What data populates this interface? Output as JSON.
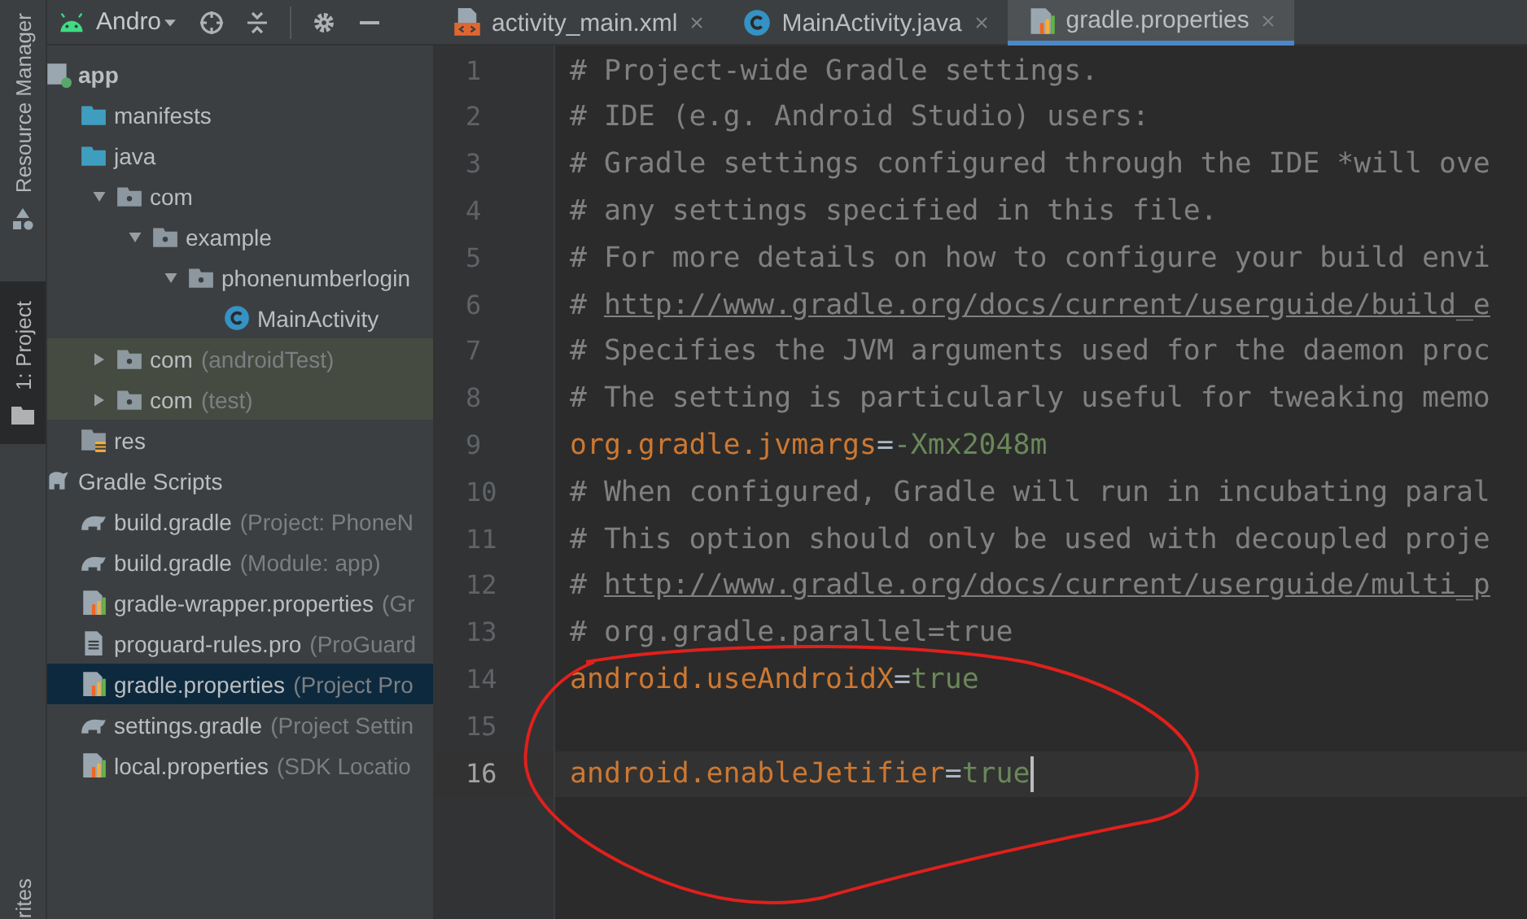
{
  "tool_strip": {
    "items": [
      {
        "label": "Resource Manager",
        "kind": "shapes",
        "selected": false
      },
      {
        "label": "1: Project",
        "kind": "folder",
        "selected": true
      }
    ],
    "bottom_label": "rites"
  },
  "project_panel": {
    "view": "Andro",
    "tree": [
      {
        "label": "app",
        "kind": "module",
        "selected": false,
        "children": [
          {
            "label": "manifests",
            "kind": "sourcefolder",
            "selected": false
          },
          {
            "label": "java",
            "kind": "sourcefolder",
            "selected": false,
            "children": [
              {
                "label": "com",
                "kind": "package",
                "expanded": true,
                "selected": false,
                "children": [
                  {
                    "label": "example",
                    "kind": "package",
                    "expanded": true,
                    "selected": false,
                    "children": [
                      {
                        "label": "phonenumberlogin",
                        "kind": "package",
                        "expanded": true,
                        "selected": false,
                        "children": [
                          {
                            "label": "MainActivity",
                            "kind": "class",
                            "selected": false
                          }
                        ]
                      }
                    ]
                  }
                ]
              },
              {
                "label": "com",
                "hint": "(androidTest)",
                "kind": "package",
                "expanded": false,
                "test": true,
                "selected": false
              },
              {
                "label": "com",
                "hint": "(test)",
                "kind": "package",
                "expanded": false,
                "test": true,
                "selected": false
              }
            ]
          },
          {
            "label": "res",
            "kind": "resfolder",
            "selected": false
          }
        ]
      },
      {
        "label": "Gradle Scripts",
        "kind": "scripts",
        "selected": false,
        "children": [
          {
            "label": "build.gradle",
            "hint": "(Project: PhoneN",
            "kind": "gradle",
            "selected": false
          },
          {
            "label": "build.gradle",
            "hint": "(Module: app)",
            "kind": "gradle",
            "selected": false
          },
          {
            "label": "gradle-wrapper.properties",
            "hint": "(Gr",
            "kind": "properties",
            "selected": false
          },
          {
            "label": "proguard-rules.pro",
            "hint": "(ProGuard",
            "kind": "text",
            "selected": false
          },
          {
            "label": "gradle.properties",
            "hint": "(Project Pro",
            "kind": "properties",
            "selected": true
          },
          {
            "label": "settings.gradle",
            "hint": "(Project Settin",
            "kind": "gradle",
            "selected": false
          },
          {
            "label": "local.properties",
            "hint": "(SDK Locatio",
            "kind": "properties",
            "selected": false
          }
        ]
      }
    ]
  },
  "tabs": [
    {
      "label": "activity_main.xml",
      "kind": "xml",
      "selected": false
    },
    {
      "label": "MainActivity.java",
      "kind": "class",
      "selected": false
    },
    {
      "label": "gradle.properties",
      "kind": "properties",
      "selected": true
    }
  ],
  "editor": {
    "lines": [
      {
        "number": "1",
        "current": false,
        "segments": [
          {
            "kind": "comment",
            "text": "# Project-wide Gradle settings."
          }
        ]
      },
      {
        "number": "2",
        "current": false,
        "segments": [
          {
            "kind": "comment",
            "text": "# IDE (e.g. Android Studio) users:"
          }
        ]
      },
      {
        "number": "3",
        "current": false,
        "segments": [
          {
            "kind": "comment",
            "text": "# Gradle settings configured through the IDE *will ove"
          }
        ]
      },
      {
        "number": "4",
        "current": false,
        "segments": [
          {
            "kind": "comment",
            "text": "# any settings specified in this file."
          }
        ]
      },
      {
        "number": "5",
        "current": false,
        "segments": [
          {
            "kind": "comment",
            "text": "# For more details on how to configure your build envi"
          }
        ]
      },
      {
        "number": "6",
        "current": false,
        "segments": [
          {
            "kind": "comment",
            "text": "# "
          },
          {
            "kind": "link",
            "text": "http://www.gradle.org/docs/current/userguide/build_e"
          }
        ]
      },
      {
        "number": "7",
        "current": false,
        "segments": [
          {
            "kind": "comment",
            "text": "# Specifies the JVM arguments used for the daemon proc"
          }
        ]
      },
      {
        "number": "8",
        "current": false,
        "segments": [
          {
            "kind": "comment",
            "text": "# The setting is particularly useful for tweaking memo"
          }
        ]
      },
      {
        "number": "9",
        "current": false,
        "segments": [
          {
            "kind": "key",
            "text": "org.gradle.jvmargs"
          },
          {
            "kind": "separator",
            "text": "="
          },
          {
            "kind": "value",
            "text": "-Xmx2048m"
          }
        ]
      },
      {
        "number": "10",
        "current": false,
        "segments": [
          {
            "kind": "comment",
            "text": "# When configured, Gradle will run in incubating paral"
          }
        ]
      },
      {
        "number": "11",
        "current": false,
        "segments": [
          {
            "kind": "comment",
            "text": "# This option should only be used with decoupled proje"
          }
        ]
      },
      {
        "number": "12",
        "current": false,
        "segments": [
          {
            "kind": "comment",
            "text": "# "
          },
          {
            "kind": "link",
            "text": "http://www.gradle.org/docs/current/userguide/multi_p"
          }
        ]
      },
      {
        "number": "13",
        "current": false,
        "segments": [
          {
            "kind": "comment",
            "text": "# org.gradle.parallel=true"
          }
        ]
      },
      {
        "number": "14",
        "current": false,
        "segments": [
          {
            "kind": "key",
            "text": "android.useAndroidX"
          },
          {
            "kind": "separator",
            "text": "="
          },
          {
            "kind": "value",
            "text": "true"
          }
        ]
      },
      {
        "number": "15",
        "current": false
      },
      {
        "number": "16",
        "current": true,
        "segments": [
          {
            "kind": "key",
            "text": "android.enableJetifier"
          },
          {
            "kind": "separator",
            "text": "="
          },
          {
            "kind": "value",
            "text": "true"
          }
        ]
      }
    ]
  }
}
